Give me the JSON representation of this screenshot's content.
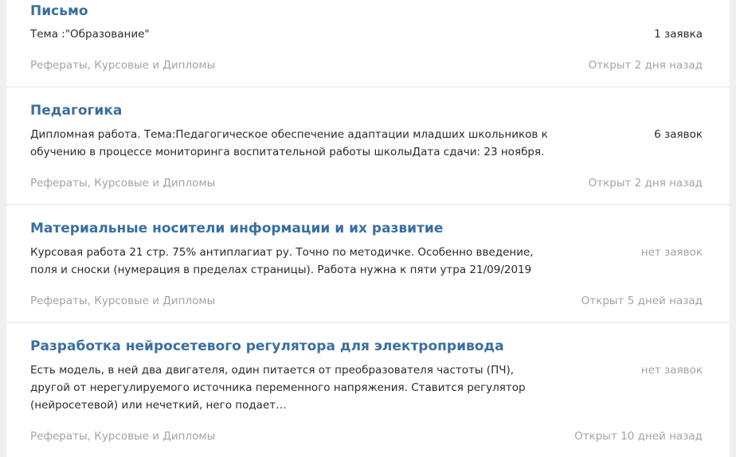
{
  "orders": [
    {
      "title": "Письмо",
      "description": "Тема :\"Образование\"",
      "bids": "1 заявка",
      "category": "Рефераты, Курсовые и Дипломы",
      "opened": "Открыт 2 дня назад"
    },
    {
      "title": "Педагогика",
      "description": "Дипломная работа. Тема:Педагогическое обеспечение адаптации младших школьников к обучению в процессе мониторинга воспитательной работы школыДата сдачи: 23 ноября.",
      "bids": "6 заявок",
      "category": "Рефераты, Курсовые и Дипломы",
      "opened": "Открыт 2 дня назад"
    },
    {
      "title": "Материальные носители информации и их развитие",
      "description": "Курсовая работа 21 стр. 75% антиплагиат ру. Точно по методичке. Особенно введение, поля и сноски (нумерация в пределах страницы). Работа нужна к пяти утра 21/09/2019",
      "bids": "нет заявок",
      "category": "Рефераты, Курсовые и Дипломы",
      "opened": "Открыт 5 дней назад"
    },
    {
      "title": "Разработка нейросетевого регулятора для электропривода",
      "description": "Есть модель, в ней два двигателя, один питается от преобразователя частоты (ПЧ), другой от нерегулируемого источника переменного напряжения. Ставится регулятор (нейросетевой) или нечеткий, него подает…",
      "bids": "нет заявок",
      "category": "Рефераты, Курсовые и Дипломы",
      "opened": "Открыт 10 дней назад"
    }
  ]
}
